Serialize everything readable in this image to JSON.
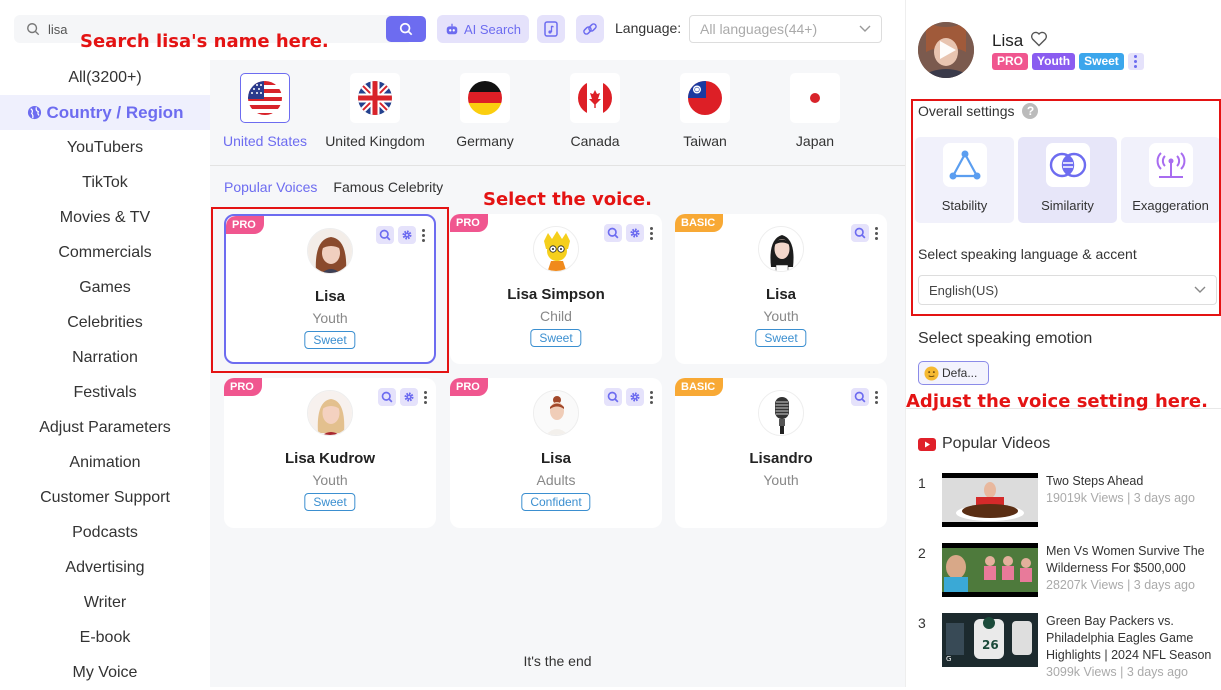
{
  "search": {
    "value": "lisa",
    "placeholder": ""
  },
  "toolbar": {
    "ai_search_label": "AI Search",
    "language_label": "Language:",
    "language_value": "All languages(44+)"
  },
  "annotations": {
    "search_note": "Search lisa's name here.",
    "select_note": "Select the voice.",
    "adjust_note": "Adjust the voice setting here."
  },
  "sidebar": {
    "items": [
      {
        "label": "All(3200+)"
      },
      {
        "label": "Country / Region",
        "active": true
      },
      {
        "label": "YouTubers"
      },
      {
        "label": "TikTok"
      },
      {
        "label": "Movies & TV"
      },
      {
        "label": "Commercials"
      },
      {
        "label": "Games"
      },
      {
        "label": "Celebrities"
      },
      {
        "label": "Narration"
      },
      {
        "label": "Festivals"
      },
      {
        "label": "Adjust Parameters"
      },
      {
        "label": "Animation"
      },
      {
        "label": "Customer Support"
      },
      {
        "label": "Podcasts"
      },
      {
        "label": "Advertising"
      },
      {
        "label": "Writer"
      },
      {
        "label": "E-book"
      },
      {
        "label": "My Voice"
      }
    ]
  },
  "countries": [
    {
      "name": "United States",
      "active": true
    },
    {
      "name": "United Kingdom"
    },
    {
      "name": "Germany"
    },
    {
      "name": "Canada"
    },
    {
      "name": "Taiwan"
    },
    {
      "name": "Japan"
    }
  ],
  "tabs": [
    {
      "label": "Popular Voices",
      "active": true
    },
    {
      "label": "Famous Celebrity"
    }
  ],
  "voices": [
    {
      "badge": "PRO",
      "name": "Lisa",
      "age": "Youth",
      "tag": "Sweet",
      "selected": true
    },
    {
      "badge": "PRO",
      "name": "Lisa Simpson",
      "age": "Child",
      "tag": "Sweet"
    },
    {
      "badge": "BASIC",
      "name": "Lisa",
      "age": "Youth",
      "tag": "Sweet"
    },
    {
      "badge": "PRO",
      "name": "Lisa Kudrow",
      "age": "Youth",
      "tag": "Sweet"
    },
    {
      "badge": "PRO",
      "name": "Lisa",
      "age": "Adults",
      "tag": "Confident"
    },
    {
      "badge": "BASIC",
      "name": "Lisandro",
      "age": "Youth",
      "tag": ""
    }
  ],
  "end_text": "It's the end",
  "detail": {
    "name": "Lisa",
    "tags": [
      "PRO",
      "Youth",
      "Sweet"
    ],
    "overall_settings_label": "Overall settings",
    "settings": [
      "Stability",
      "Similarity",
      "Exaggeration"
    ],
    "accent_label": "Select speaking language & accent",
    "accent_value": "English(US)",
    "emotion_label": "Select speaking emotion",
    "emotion_value": "Defa..."
  },
  "popular_videos": {
    "label": "Popular Videos",
    "items": [
      {
        "rank": "1",
        "title": "Two Steps Ahead",
        "meta": "19019k Views | 3 days ago"
      },
      {
        "rank": "2",
        "title": "Men Vs Women Survive The Wilderness For $500,000",
        "meta": "28207k Views | 3 days ago"
      },
      {
        "rank": "3",
        "title": "Green Bay Packers vs. Philadelphia Eagles Game Highlights | 2024 NFL Season",
        "meta": "3099k Views | 3 days ago"
      }
    ]
  },
  "colors": {
    "accent": "#6d6cf0",
    "pro": "#f0568f",
    "basic": "#f8a935",
    "annotation": "#e41313"
  }
}
